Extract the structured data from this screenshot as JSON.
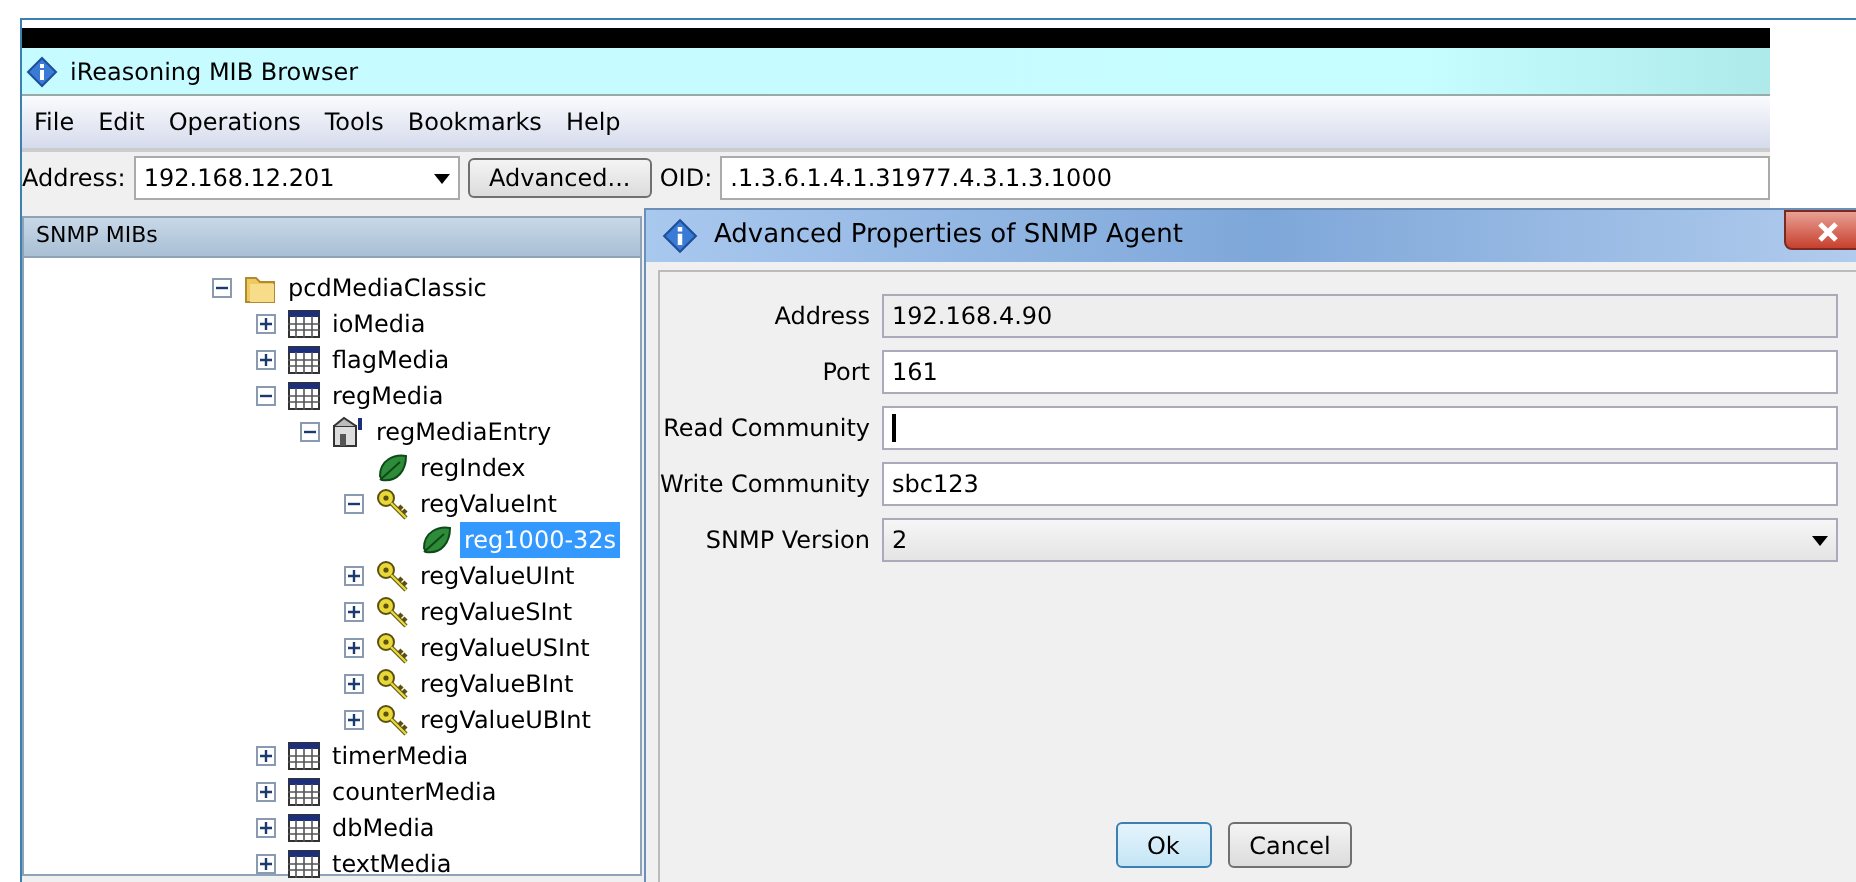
{
  "window": {
    "title": "iReasoning MIB Browser"
  },
  "menu": [
    "File",
    "Edit",
    "Operations",
    "Tools",
    "Bookmarks",
    "Help"
  ],
  "toolbar": {
    "address_label": "Address:",
    "address_value": "192.168.12.201",
    "advanced_button": "Advanced...",
    "oid_label": "OID:",
    "oid_value": ".1.3.6.1.4.1.31977.4.3.1.3.1000"
  },
  "mib_panel": {
    "title": "SNMP MIBs",
    "tree": [
      {
        "label": "pcdMediaClassic",
        "kind": "folder",
        "expanded": true,
        "selected": false,
        "children": [
          {
            "label": "ioMedia",
            "kind": "table",
            "expanded": false,
            "selected": false
          },
          {
            "label": "flagMedia",
            "kind": "table",
            "expanded": false,
            "selected": false
          },
          {
            "label": "regMedia",
            "kind": "table",
            "expanded": true,
            "selected": false,
            "children": [
              {
                "label": "regMediaEntry",
                "kind": "entry",
                "expanded": true,
                "selected": false,
                "children": [
                  {
                    "label": "regIndex",
                    "kind": "leaf",
                    "selected": false
                  },
                  {
                    "label": "regValueInt",
                    "kind": "key",
                    "expanded": true,
                    "selected": false,
                    "children": [
                      {
                        "label": "reg1000-32s",
                        "kind": "leaf",
                        "selected": true
                      }
                    ]
                  },
                  {
                    "label": "regValueUInt",
                    "kind": "key",
                    "expanded": false,
                    "selected": false
                  },
                  {
                    "label": "regValueSInt",
                    "kind": "key",
                    "expanded": false,
                    "selected": false
                  },
                  {
                    "label": "regValueUSInt",
                    "kind": "key",
                    "expanded": false,
                    "selected": false
                  },
                  {
                    "label": "regValueBInt",
                    "kind": "key",
                    "expanded": false,
                    "selected": false
                  },
                  {
                    "label": "regValueUBInt",
                    "kind": "key",
                    "expanded": false,
                    "selected": false
                  }
                ]
              }
            ]
          },
          {
            "label": "timerMedia",
            "kind": "table",
            "expanded": false,
            "selected": false
          },
          {
            "label": "counterMedia",
            "kind": "table",
            "expanded": false,
            "selected": false
          },
          {
            "label": "dbMedia",
            "kind": "table",
            "expanded": false,
            "selected": false
          },
          {
            "label": "textMedia",
            "kind": "table",
            "expanded": false,
            "selected": false
          }
        ]
      }
    ]
  },
  "dialog": {
    "title": "Advanced Properties of SNMP Agent",
    "fields": [
      {
        "label": "Address",
        "value": "192.168.4.90",
        "kind": "text",
        "disabled": true
      },
      {
        "label": "Port",
        "value": "161",
        "kind": "text",
        "disabled": false
      },
      {
        "label": "Read Community",
        "kind": "text",
        "disabled": false,
        "focused": true
      },
      {
        "label": "Write Community",
        "value": "sbc123",
        "kind": "text",
        "disabled": false
      },
      {
        "label": "SNMP Version",
        "value": "2",
        "kind": "select",
        "disabled": false
      }
    ],
    "buttons": [
      {
        "label": "Ok",
        "default": true
      },
      {
        "label": "Cancel",
        "default": false
      }
    ]
  }
}
